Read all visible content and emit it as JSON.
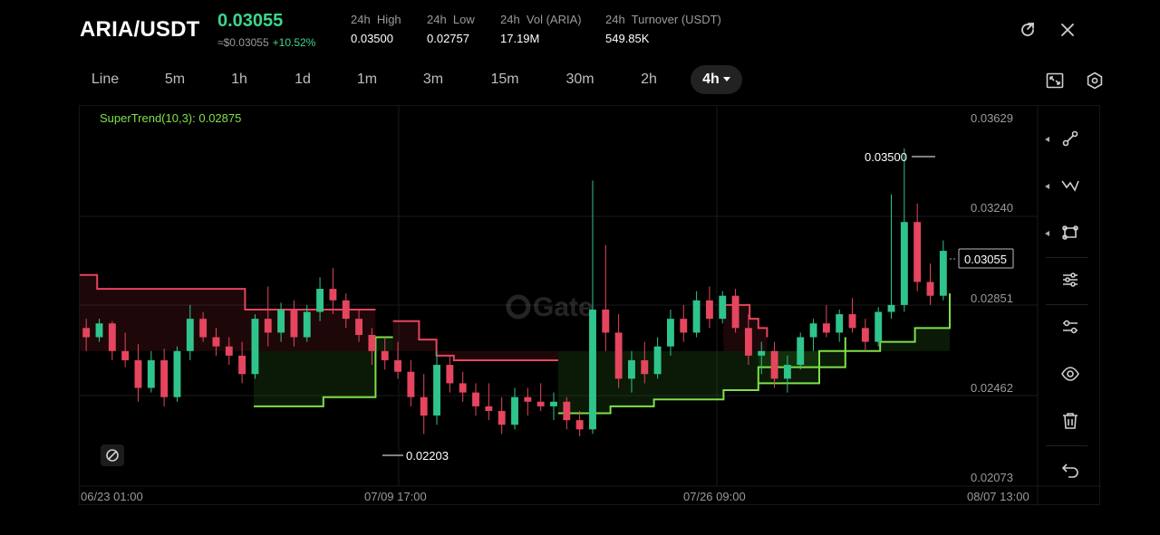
{
  "header": {
    "pair": "ARIA/USDT",
    "price": "0.03055",
    "price_usd": "≈$0.03055",
    "change": "+10.52%",
    "stats": [
      {
        "label": "24h  High",
        "value": "0.03500"
      },
      {
        "label": "24h  Low",
        "value": "0.02757"
      },
      {
        "label": "24h  Vol (ARIA)",
        "value": "17.19M"
      },
      {
        "label": "24h  Turnover (USDT)",
        "value": "549.85K"
      }
    ],
    "icons": [
      "share-icon",
      "close-icon"
    ]
  },
  "timeframes": {
    "items": [
      "Line",
      "5m",
      "1h",
      "1d",
      "1m",
      "3m",
      "15m",
      "30m",
      "2h",
      "4h"
    ],
    "active": "4h",
    "right_icons": [
      "fullscreen-icon",
      "settings-icon"
    ]
  },
  "chart": {
    "indicator": "SuperTrend(10,3): 0.02875",
    "watermark": "Gate",
    "last_price_label": "0.03055",
    "high_marker": "0.03500",
    "low_marker": "0.02203",
    "y_ticks": [
      "0.03629",
      "0.03240",
      "0.02851",
      "0.02462",
      "0.02073"
    ],
    "x_ticks": [
      "06/23 01:00",
      "07/09 17:00",
      "07/26 09:00",
      "08/07 13:00"
    ],
    "colors": {
      "up": "#2fc48c",
      "down": "#e5455e",
      "supertrend_up": "#7ee04a",
      "supertrend_down": "#e5455e"
    }
  },
  "chart_data": {
    "type": "candlestick",
    "timeframe": "4h",
    "ylim": [
      0.02073,
      0.03629
    ],
    "x_range": [
      "06/23 01:00",
      "08/07 13:00"
    ],
    "last": 0.03055,
    "visible_high": 0.035,
    "visible_low": 0.02203,
    "supertrend": {
      "params": "10,3",
      "value": 0.02875,
      "segments": [
        {
          "trend": "down",
          "points": [
            [
              0.0,
              0.0295
            ],
            [
              0.02,
              0.0289
            ],
            [
              0.16,
              0.0289
            ],
            [
              0.19,
              0.028
            ],
            [
              0.34,
              0.028
            ]
          ]
        },
        {
          "trend": "up",
          "points": [
            [
              0.2,
              0.0238
            ],
            [
              0.25,
              0.0238
            ],
            [
              0.28,
              0.0242
            ],
            [
              0.34,
              0.0268
            ],
            [
              0.36,
              0.0268
            ]
          ]
        },
        {
          "trend": "down",
          "points": [
            [
              0.36,
              0.0275
            ],
            [
              0.39,
              0.0267
            ],
            [
              0.41,
              0.026
            ],
            [
              0.43,
              0.0258
            ],
            [
              0.55,
              0.0258
            ]
          ]
        },
        {
          "trend": "up",
          "points": [
            [
              0.55,
              0.0235
            ],
            [
              0.6,
              0.0235
            ],
            [
              0.61,
              0.0238
            ],
            [
              0.66,
              0.0241
            ],
            [
              0.74,
              0.0245
            ],
            [
              0.78,
              0.0255
            ],
            [
              0.88,
              0.0268
            ]
          ]
        },
        {
          "trend": "down",
          "points": [
            [
              0.74,
              0.0282
            ],
            [
              0.77,
              0.0276
            ],
            [
              0.78,
              0.0272
            ],
            [
              0.79,
              0.0268
            ]
          ]
        },
        {
          "trend": "up",
          "points": [
            [
              0.78,
              0.0248
            ],
            [
              0.85,
              0.0262
            ],
            [
              0.9,
              0.0262
            ],
            [
              0.92,
              0.0266
            ],
            [
              0.95,
              0.0266
            ],
            [
              0.96,
              0.0272
            ],
            [
              1.0,
              0.0287
            ]
          ]
        }
      ]
    },
    "candles": [
      {
        "o": 0.0272,
        "h": 0.0276,
        "l": 0.0262,
        "c": 0.0268
      },
      {
        "o": 0.0268,
        "h": 0.0276,
        "l": 0.0266,
        "c": 0.0274
      },
      {
        "o": 0.0274,
        "h": 0.0275,
        "l": 0.0258,
        "c": 0.0262
      },
      {
        "o": 0.0262,
        "h": 0.027,
        "l": 0.0255,
        "c": 0.0258
      },
      {
        "o": 0.0258,
        "h": 0.0265,
        "l": 0.024,
        "c": 0.0246
      },
      {
        "o": 0.0246,
        "h": 0.0262,
        "l": 0.0244,
        "c": 0.0258
      },
      {
        "o": 0.0258,
        "h": 0.0263,
        "l": 0.0238,
        "c": 0.0242
      },
      {
        "o": 0.0242,
        "h": 0.0264,
        "l": 0.024,
        "c": 0.0262
      },
      {
        "o": 0.0262,
        "h": 0.0282,
        "l": 0.0258,
        "c": 0.0276
      },
      {
        "o": 0.0276,
        "h": 0.0279,
        "l": 0.0266,
        "c": 0.0268
      },
      {
        "o": 0.0268,
        "h": 0.0272,
        "l": 0.026,
        "c": 0.0264
      },
      {
        "o": 0.0264,
        "h": 0.0268,
        "l": 0.0256,
        "c": 0.026
      },
      {
        "o": 0.026,
        "h": 0.0266,
        "l": 0.0248,
        "c": 0.0252
      },
      {
        "o": 0.0252,
        "h": 0.0278,
        "l": 0.025,
        "c": 0.0276
      },
      {
        "o": 0.0276,
        "h": 0.029,
        "l": 0.0264,
        "c": 0.027
      },
      {
        "o": 0.027,
        "h": 0.0283,
        "l": 0.0266,
        "c": 0.028
      },
      {
        "o": 0.028,
        "h": 0.0284,
        "l": 0.0264,
        "c": 0.0268
      },
      {
        "o": 0.0268,
        "h": 0.0282,
        "l": 0.0266,
        "c": 0.0279
      },
      {
        "o": 0.0279,
        "h": 0.0294,
        "l": 0.0275,
        "c": 0.0289
      },
      {
        "o": 0.0289,
        "h": 0.0298,
        "l": 0.0278,
        "c": 0.0284
      },
      {
        "o": 0.0284,
        "h": 0.0287,
        "l": 0.0272,
        "c": 0.0276
      },
      {
        "o": 0.0276,
        "h": 0.028,
        "l": 0.0266,
        "c": 0.0269
      },
      {
        "o": 0.0269,
        "h": 0.0272,
        "l": 0.0256,
        "c": 0.0262
      },
      {
        "o": 0.0262,
        "h": 0.0268,
        "l": 0.0254,
        "c": 0.0258
      },
      {
        "o": 0.0258,
        "h": 0.0266,
        "l": 0.025,
        "c": 0.0253
      },
      {
        "o": 0.0253,
        "h": 0.0258,
        "l": 0.0238,
        "c": 0.0242
      },
      {
        "o": 0.0242,
        "h": 0.0252,
        "l": 0.0226,
        "c": 0.0234
      },
      {
        "o": 0.0234,
        "h": 0.0262,
        "l": 0.023,
        "c": 0.0256
      },
      {
        "o": 0.0256,
        "h": 0.026,
        "l": 0.0244,
        "c": 0.0248
      },
      {
        "o": 0.0248,
        "h": 0.0253,
        "l": 0.024,
        "c": 0.0244
      },
      {
        "o": 0.0244,
        "h": 0.0248,
        "l": 0.0234,
        "c": 0.0238
      },
      {
        "o": 0.0238,
        "h": 0.0248,
        "l": 0.0232,
        "c": 0.0236
      },
      {
        "o": 0.0236,
        "h": 0.0242,
        "l": 0.0226,
        "c": 0.023
      },
      {
        "o": 0.023,
        "h": 0.0246,
        "l": 0.0228,
        "c": 0.0242
      },
      {
        "o": 0.0242,
        "h": 0.0246,
        "l": 0.0234,
        "c": 0.024
      },
      {
        "o": 0.024,
        "h": 0.0248,
        "l": 0.0236,
        "c": 0.0238
      },
      {
        "o": 0.0238,
        "h": 0.0244,
        "l": 0.0232,
        "c": 0.024
      },
      {
        "o": 0.024,
        "h": 0.0242,
        "l": 0.0228,
        "c": 0.0232
      },
      {
        "o": 0.0232,
        "h": 0.0236,
        "l": 0.0225,
        "c": 0.0228
      },
      {
        "o": 0.0228,
        "h": 0.0336,
        "l": 0.0226,
        "c": 0.028
      },
      {
        "o": 0.028,
        "h": 0.0308,
        "l": 0.0262,
        "c": 0.027
      },
      {
        "o": 0.027,
        "h": 0.0278,
        "l": 0.0246,
        "c": 0.025
      },
      {
        "o": 0.025,
        "h": 0.0262,
        "l": 0.0244,
        "c": 0.0258
      },
      {
        "o": 0.0258,
        "h": 0.0266,
        "l": 0.0248,
        "c": 0.0252
      },
      {
        "o": 0.0252,
        "h": 0.0268,
        "l": 0.025,
        "c": 0.0264
      },
      {
        "o": 0.0264,
        "h": 0.028,
        "l": 0.026,
        "c": 0.0276
      },
      {
        "o": 0.0276,
        "h": 0.0282,
        "l": 0.0266,
        "c": 0.027
      },
      {
        "o": 0.027,
        "h": 0.0288,
        "l": 0.0268,
        "c": 0.0284
      },
      {
        "o": 0.0284,
        "h": 0.029,
        "l": 0.0272,
        "c": 0.0276
      },
      {
        "o": 0.0276,
        "h": 0.0288,
        "l": 0.0274,
        "c": 0.0286
      },
      {
        "o": 0.0286,
        "h": 0.0289,
        "l": 0.027,
        "c": 0.0272
      },
      {
        "o": 0.0272,
        "h": 0.0278,
        "l": 0.0256,
        "c": 0.026
      },
      {
        "o": 0.026,
        "h": 0.0266,
        "l": 0.0252,
        "c": 0.0262
      },
      {
        "o": 0.0262,
        "h": 0.0266,
        "l": 0.0246,
        "c": 0.025
      },
      {
        "o": 0.025,
        "h": 0.026,
        "l": 0.0244,
        "c": 0.0256
      },
      {
        "o": 0.0256,
        "h": 0.027,
        "l": 0.0254,
        "c": 0.0268
      },
      {
        "o": 0.0268,
        "h": 0.0276,
        "l": 0.0262,
        "c": 0.0274
      },
      {
        "o": 0.0274,
        "h": 0.0282,
        "l": 0.0268,
        "c": 0.027
      },
      {
        "o": 0.027,
        "h": 0.028,
        "l": 0.0266,
        "c": 0.0278
      },
      {
        "o": 0.0278,
        "h": 0.0285,
        "l": 0.027,
        "c": 0.0272
      },
      {
        "o": 0.0272,
        "h": 0.0276,
        "l": 0.0262,
        "c": 0.0266
      },
      {
        "o": 0.0266,
        "h": 0.0281,
        "l": 0.0264,
        "c": 0.0279
      },
      {
        "o": 0.0279,
        "h": 0.033,
        "l": 0.0276,
        "c": 0.0282
      },
      {
        "o": 0.0282,
        "h": 0.035,
        "l": 0.0279,
        "c": 0.0318
      },
      {
        "o": 0.0318,
        "h": 0.0326,
        "l": 0.0288,
        "c": 0.0292
      },
      {
        "o": 0.0292,
        "h": 0.03,
        "l": 0.0282,
        "c": 0.0286
      },
      {
        "o": 0.0286,
        "h": 0.031,
        "l": 0.0284,
        "c": 0.03055
      }
    ]
  },
  "toolbar": {
    "items": [
      "trend-line-icon",
      "pattern-tool-icon",
      "shape-tool-icon",
      "indicator-settings-icon",
      "chart-settings-icon",
      "visibility-icon",
      "delete-icon",
      "undo-icon"
    ]
  }
}
